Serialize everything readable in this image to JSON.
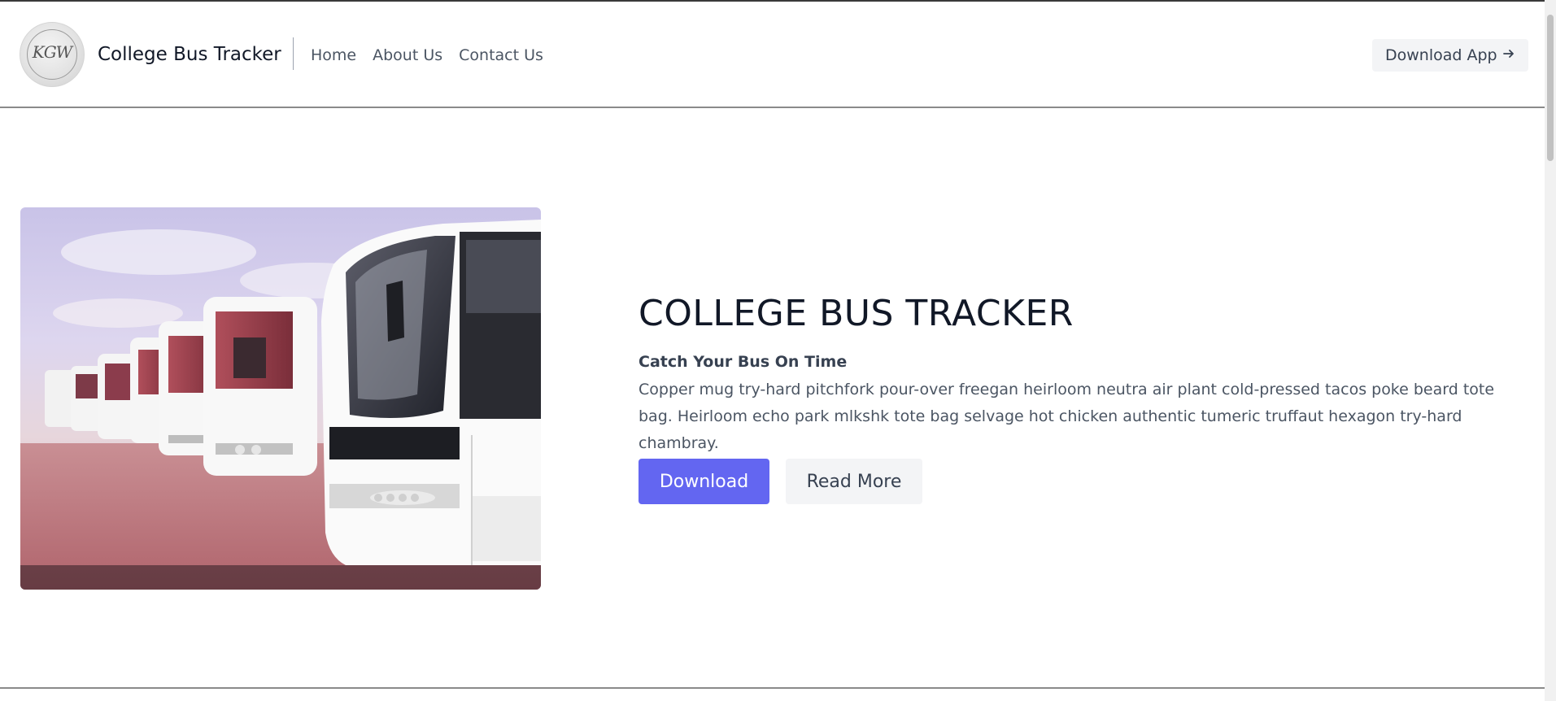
{
  "header": {
    "brand": "College Bus Tracker",
    "nav": [
      "Home",
      "About Us",
      "Contact Us"
    ],
    "download_app_label": "Download App",
    "download_app_icon": "arrow-right-icon",
    "logo_text": "KGW"
  },
  "hero": {
    "title": "COLLEGE BUS TRACKER",
    "subtitle": "Catch Your Bus On Time",
    "paragraph": "Copper mug try-hard pitchfork pour-over freegan heirloom neutra air plant cold-pressed tacos poke beard tote bag. Heirloom echo park mlkshk tote bag selvage hot chicken authentic tumeric truffaut hexagon try-hard chambray.",
    "primary_button": "Download",
    "secondary_button": "Read More"
  },
  "colors": {
    "accent": "#6366f1",
    "button_secondary_bg": "#f3f4f6",
    "text_dark": "#111827",
    "text_muted": "#4b5563"
  }
}
